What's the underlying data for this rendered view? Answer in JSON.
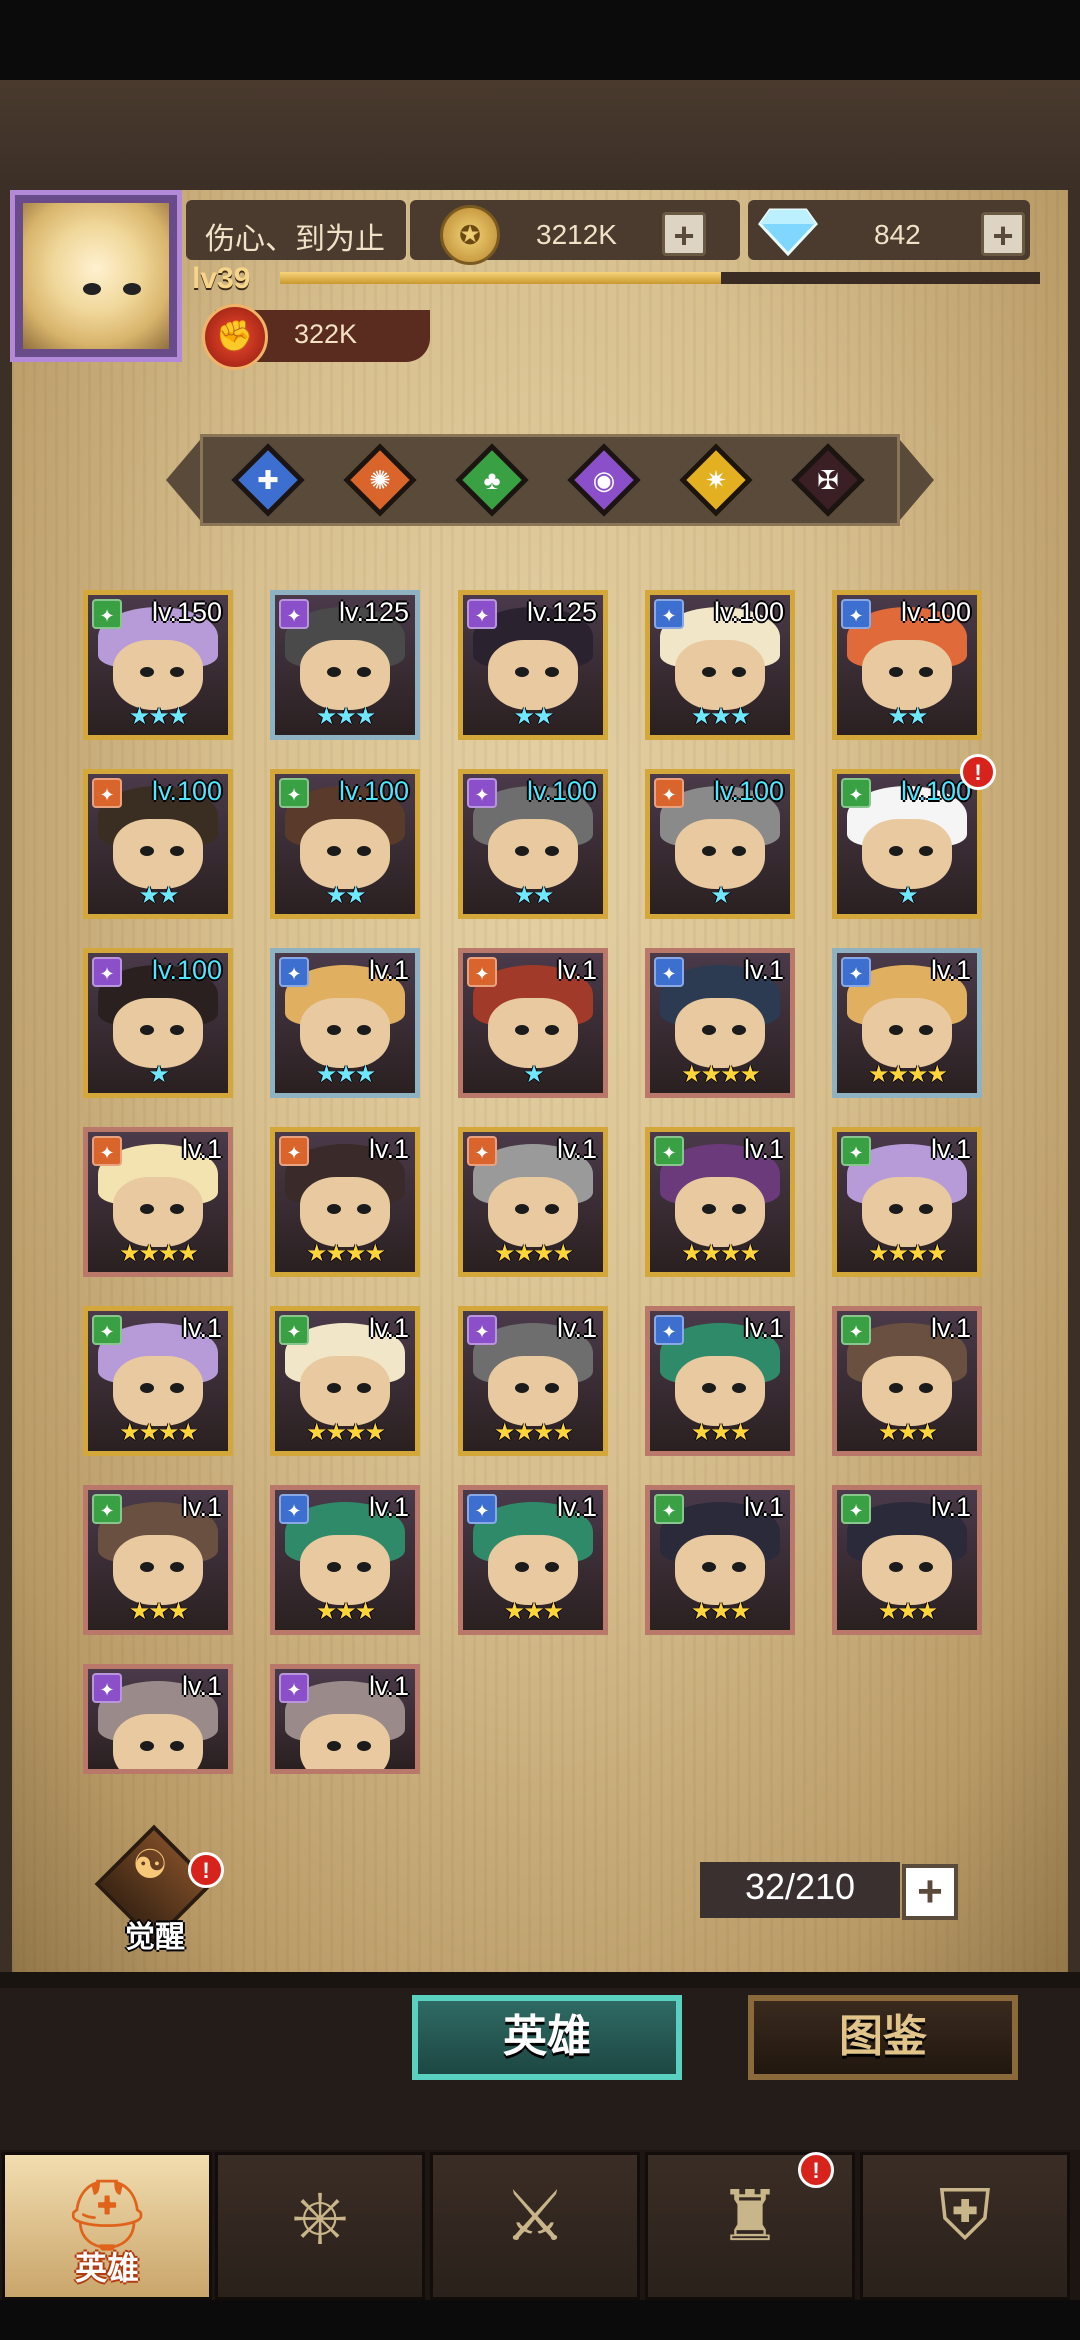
{
  "player": {
    "name": "伤心、到为止",
    "level": "lv39",
    "power": "322K",
    "xp_fraction": 0.58
  },
  "resources": {
    "coins": "3212K",
    "gems": "842"
  },
  "factions": [
    {
      "name": "blue-faction",
      "color": "#3d6fd1",
      "icon": "✚"
    },
    {
      "name": "orange-faction",
      "color": "#d9642c",
      "icon": "✺"
    },
    {
      "name": "green-faction",
      "color": "#39a043",
      "icon": "♣"
    },
    {
      "name": "purple-faction",
      "color": "#8a4fc9",
      "icon": "◉"
    },
    {
      "name": "gold-faction",
      "color": "#e3b021",
      "icon": "✷"
    },
    {
      "name": "dark-faction",
      "color": "#3a1f24",
      "icon": "✠"
    }
  ],
  "heroes": [
    {
      "level": "lv.150",
      "stars": "★★★",
      "star_color": "cyan",
      "faction_color": "#39a043"
    },
    {
      "level": "lv.125",
      "stars": "★★★",
      "star_color": "cyan",
      "faction_color": "#8a4fc9"
    },
    {
      "level": "lv.125",
      "stars": "★★",
      "star_color": "cyan",
      "faction_color": "#8a4fc9"
    },
    {
      "level": "lv.100",
      "stars": "★★★",
      "star_color": "cyan",
      "faction_color": "#3d6fd1"
    },
    {
      "level": "lv.100",
      "stars": "★★",
      "star_color": "cyan",
      "faction_color": "#3d6fd1"
    },
    {
      "level": "lv.100",
      "stars": "★★",
      "star_color": "cyan",
      "faction_color": "#d9642c"
    },
    {
      "level": "lv.100",
      "stars": "★★",
      "star_color": "cyan",
      "faction_color": "#39a043"
    },
    {
      "level": "lv.100",
      "stars": "★★",
      "star_color": "cyan",
      "faction_color": "#8a4fc9"
    },
    {
      "level": "lv.100",
      "stars": "★",
      "star_color": "cyan",
      "faction_color": "#d9642c"
    },
    {
      "level": "lv.100",
      "stars": "★",
      "star_color": "cyan",
      "faction_color": "#39a043"
    },
    {
      "level": "lv.100",
      "stars": "★",
      "star_color": "cyan",
      "faction_color": "#8a4fc9"
    },
    {
      "level": "lv.1",
      "stars": "★★★",
      "star_color": "cyan",
      "faction_color": "#3d6fd1"
    },
    {
      "level": "lv.1",
      "stars": "★",
      "star_color": "cyan",
      "faction_color": "#d9642c"
    },
    {
      "level": "lv.1",
      "stars": "★★★★",
      "star_color": "gold",
      "faction_color": "#3d6fd1"
    },
    {
      "level": "lv.1",
      "stars": "★★★★",
      "star_color": "gold",
      "faction_color": "#3d6fd1"
    },
    {
      "level": "lv.1",
      "stars": "★★★★",
      "star_color": "gold",
      "faction_color": "#d9642c"
    },
    {
      "level": "lv.1",
      "stars": "★★★★",
      "star_color": "gold",
      "faction_color": "#d9642c"
    },
    {
      "level": "lv.1",
      "stars": "★★★★",
      "star_color": "gold",
      "faction_color": "#d9642c"
    },
    {
      "level": "lv.1",
      "stars": "★★★★",
      "star_color": "gold",
      "faction_color": "#39a043"
    },
    {
      "level": "lv.1",
      "stars": "★★★★",
      "star_color": "gold",
      "faction_color": "#39a043"
    },
    {
      "level": "lv.1",
      "stars": "★★★★",
      "star_color": "gold",
      "faction_color": "#39a043"
    },
    {
      "level": "lv.1",
      "stars": "★★★★",
      "star_color": "gold",
      "faction_color": "#39a043"
    },
    {
      "level": "lv.1",
      "stars": "★★★★",
      "star_color": "gold",
      "faction_color": "#8a4fc9"
    },
    {
      "level": "lv.1",
      "stars": "★★★",
      "star_color": "gold",
      "faction_color": "#3d6fd1"
    },
    {
      "level": "lv.1",
      "stars": "★★★",
      "star_color": "gold",
      "faction_color": "#39a043"
    },
    {
      "level": "lv.1",
      "stars": "★★★",
      "star_color": "gold",
      "faction_color": "#39a043"
    },
    {
      "level": "lv.1",
      "stars": "★★★",
      "star_color": "gold",
      "faction_color": "#3d6fd1"
    },
    {
      "level": "lv.1",
      "stars": "★★★",
      "star_color": "gold",
      "faction_color": "#3d6fd1"
    },
    {
      "level": "lv.1",
      "stars": "★★★",
      "star_color": "gold",
      "faction_color": "#39a043"
    },
    {
      "level": "lv.1",
      "stars": "★★★",
      "star_color": "gold",
      "faction_color": "#39a043"
    },
    {
      "level": "lv.1",
      "stars": "",
      "star_color": "gold",
      "faction_color": "#8a4fc9"
    },
    {
      "level": "lv.1",
      "stars": "",
      "star_color": "gold",
      "faction_color": "#8a4fc9"
    }
  ],
  "awaken": {
    "label": "觉醒",
    "alert": "!"
  },
  "hero_count": "32/210",
  "toggle_tabs": {
    "heroes": "英雄",
    "codex": "图鉴"
  },
  "nav": {
    "heroes_label": "英雄",
    "alert": "!"
  }
}
